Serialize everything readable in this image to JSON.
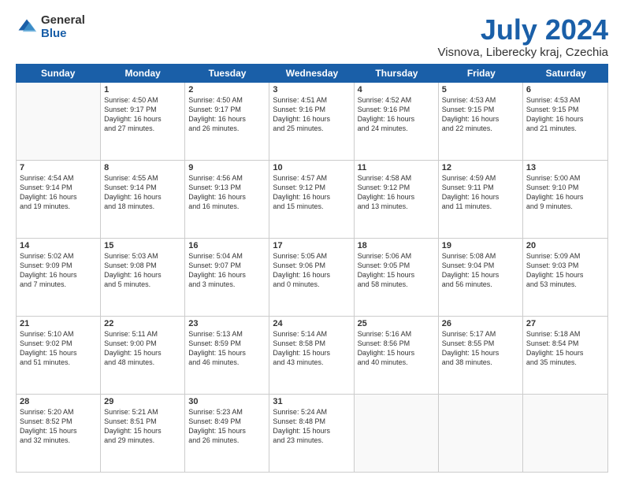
{
  "logo": {
    "general": "General",
    "blue": "Blue"
  },
  "header": {
    "title": "July 2024",
    "subtitle": "Visnova, Liberecky kraj, Czechia"
  },
  "weekdays": [
    "Sunday",
    "Monday",
    "Tuesday",
    "Wednesday",
    "Thursday",
    "Friday",
    "Saturday"
  ],
  "rows": [
    [
      {
        "day": "",
        "lines": []
      },
      {
        "day": "1",
        "lines": [
          "Sunrise: 4:50 AM",
          "Sunset: 9:17 PM",
          "Daylight: 16 hours",
          "and 27 minutes."
        ]
      },
      {
        "day": "2",
        "lines": [
          "Sunrise: 4:50 AM",
          "Sunset: 9:17 PM",
          "Daylight: 16 hours",
          "and 26 minutes."
        ]
      },
      {
        "day": "3",
        "lines": [
          "Sunrise: 4:51 AM",
          "Sunset: 9:16 PM",
          "Daylight: 16 hours",
          "and 25 minutes."
        ]
      },
      {
        "day": "4",
        "lines": [
          "Sunrise: 4:52 AM",
          "Sunset: 9:16 PM",
          "Daylight: 16 hours",
          "and 24 minutes."
        ]
      },
      {
        "day": "5",
        "lines": [
          "Sunrise: 4:53 AM",
          "Sunset: 9:15 PM",
          "Daylight: 16 hours",
          "and 22 minutes."
        ]
      },
      {
        "day": "6",
        "lines": [
          "Sunrise: 4:53 AM",
          "Sunset: 9:15 PM",
          "Daylight: 16 hours",
          "and 21 minutes."
        ]
      }
    ],
    [
      {
        "day": "7",
        "lines": [
          "Sunrise: 4:54 AM",
          "Sunset: 9:14 PM",
          "Daylight: 16 hours",
          "and 19 minutes."
        ]
      },
      {
        "day": "8",
        "lines": [
          "Sunrise: 4:55 AM",
          "Sunset: 9:14 PM",
          "Daylight: 16 hours",
          "and 18 minutes."
        ]
      },
      {
        "day": "9",
        "lines": [
          "Sunrise: 4:56 AM",
          "Sunset: 9:13 PM",
          "Daylight: 16 hours",
          "and 16 minutes."
        ]
      },
      {
        "day": "10",
        "lines": [
          "Sunrise: 4:57 AM",
          "Sunset: 9:12 PM",
          "Daylight: 16 hours",
          "and 15 minutes."
        ]
      },
      {
        "day": "11",
        "lines": [
          "Sunrise: 4:58 AM",
          "Sunset: 9:12 PM",
          "Daylight: 16 hours",
          "and 13 minutes."
        ]
      },
      {
        "day": "12",
        "lines": [
          "Sunrise: 4:59 AM",
          "Sunset: 9:11 PM",
          "Daylight: 16 hours",
          "and 11 minutes."
        ]
      },
      {
        "day": "13",
        "lines": [
          "Sunrise: 5:00 AM",
          "Sunset: 9:10 PM",
          "Daylight: 16 hours",
          "and 9 minutes."
        ]
      }
    ],
    [
      {
        "day": "14",
        "lines": [
          "Sunrise: 5:02 AM",
          "Sunset: 9:09 PM",
          "Daylight: 16 hours",
          "and 7 minutes."
        ]
      },
      {
        "day": "15",
        "lines": [
          "Sunrise: 5:03 AM",
          "Sunset: 9:08 PM",
          "Daylight: 16 hours",
          "and 5 minutes."
        ]
      },
      {
        "day": "16",
        "lines": [
          "Sunrise: 5:04 AM",
          "Sunset: 9:07 PM",
          "Daylight: 16 hours",
          "and 3 minutes."
        ]
      },
      {
        "day": "17",
        "lines": [
          "Sunrise: 5:05 AM",
          "Sunset: 9:06 PM",
          "Daylight: 16 hours",
          "and 0 minutes."
        ]
      },
      {
        "day": "18",
        "lines": [
          "Sunrise: 5:06 AM",
          "Sunset: 9:05 PM",
          "Daylight: 15 hours",
          "and 58 minutes."
        ]
      },
      {
        "day": "19",
        "lines": [
          "Sunrise: 5:08 AM",
          "Sunset: 9:04 PM",
          "Daylight: 15 hours",
          "and 56 minutes."
        ]
      },
      {
        "day": "20",
        "lines": [
          "Sunrise: 5:09 AM",
          "Sunset: 9:03 PM",
          "Daylight: 15 hours",
          "and 53 minutes."
        ]
      }
    ],
    [
      {
        "day": "21",
        "lines": [
          "Sunrise: 5:10 AM",
          "Sunset: 9:02 PM",
          "Daylight: 15 hours",
          "and 51 minutes."
        ]
      },
      {
        "day": "22",
        "lines": [
          "Sunrise: 5:11 AM",
          "Sunset: 9:00 PM",
          "Daylight: 15 hours",
          "and 48 minutes."
        ]
      },
      {
        "day": "23",
        "lines": [
          "Sunrise: 5:13 AM",
          "Sunset: 8:59 PM",
          "Daylight: 15 hours",
          "and 46 minutes."
        ]
      },
      {
        "day": "24",
        "lines": [
          "Sunrise: 5:14 AM",
          "Sunset: 8:58 PM",
          "Daylight: 15 hours",
          "and 43 minutes."
        ]
      },
      {
        "day": "25",
        "lines": [
          "Sunrise: 5:16 AM",
          "Sunset: 8:56 PM",
          "Daylight: 15 hours",
          "and 40 minutes."
        ]
      },
      {
        "day": "26",
        "lines": [
          "Sunrise: 5:17 AM",
          "Sunset: 8:55 PM",
          "Daylight: 15 hours",
          "and 38 minutes."
        ]
      },
      {
        "day": "27",
        "lines": [
          "Sunrise: 5:18 AM",
          "Sunset: 8:54 PM",
          "Daylight: 15 hours",
          "and 35 minutes."
        ]
      }
    ],
    [
      {
        "day": "28",
        "lines": [
          "Sunrise: 5:20 AM",
          "Sunset: 8:52 PM",
          "Daylight: 15 hours",
          "and 32 minutes."
        ]
      },
      {
        "day": "29",
        "lines": [
          "Sunrise: 5:21 AM",
          "Sunset: 8:51 PM",
          "Daylight: 15 hours",
          "and 29 minutes."
        ]
      },
      {
        "day": "30",
        "lines": [
          "Sunrise: 5:23 AM",
          "Sunset: 8:49 PM",
          "Daylight: 15 hours",
          "and 26 minutes."
        ]
      },
      {
        "day": "31",
        "lines": [
          "Sunrise: 5:24 AM",
          "Sunset: 8:48 PM",
          "Daylight: 15 hours",
          "and 23 minutes."
        ]
      },
      {
        "day": "",
        "lines": []
      },
      {
        "day": "",
        "lines": []
      },
      {
        "day": "",
        "lines": []
      }
    ]
  ]
}
